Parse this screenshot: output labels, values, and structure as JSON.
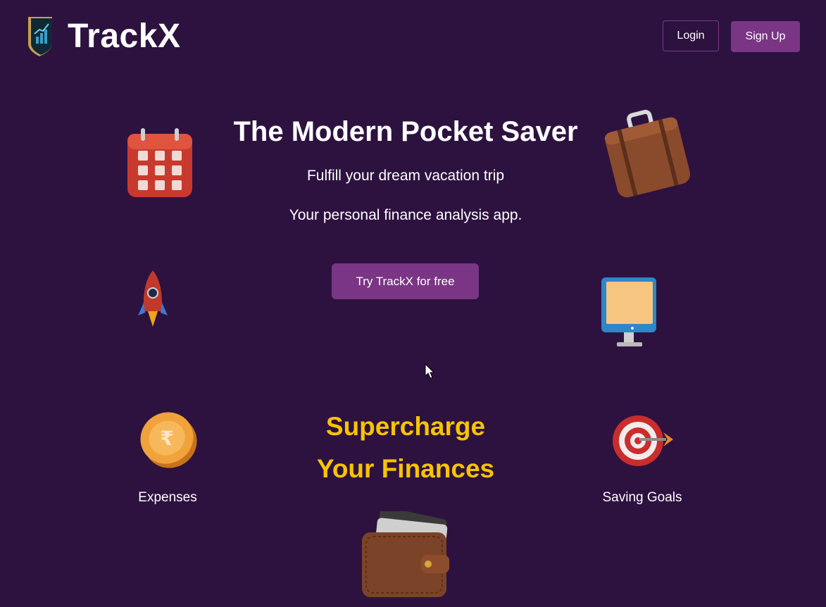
{
  "header": {
    "brand": "TrackX",
    "login_label": "Login",
    "signup_label": "Sign Up"
  },
  "hero": {
    "title": "The Modern Pocket Saver",
    "subtitle_1": "Fulfill your dream vacation trip",
    "subtitle_2": "Your personal finance analysis app.",
    "cta_label": "Try TrackX for free"
  },
  "features": {
    "heading_line_1": "Supercharge",
    "heading_line_2": "Your Finances",
    "expenses_label": "Expenses",
    "goals_label": "Saving Goals"
  },
  "icons": [
    "logo-shield-icon",
    "calendar-icon",
    "suitcase-icon",
    "rocket-icon",
    "monitor-icon",
    "rupee-coin-icon",
    "target-icon",
    "wallet-icon"
  ],
  "colors": {
    "background": "#2d1240",
    "accent": "#7a3585",
    "highlight": "#f8c400"
  }
}
